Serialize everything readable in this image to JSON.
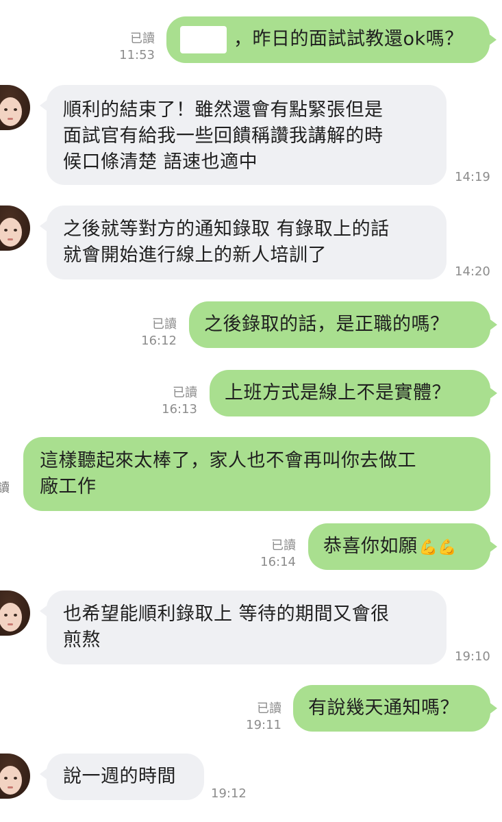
{
  "messages": [
    {
      "id": "m1",
      "side": "me",
      "status": "已讀",
      "time": "11:53",
      "text": "，昨日的面試試教還ok嗎？"
    },
    {
      "id": "m2",
      "side": "them",
      "time": "14:19",
      "lines": [
        "順利的結束了！雖然還會有點緊張但是",
        "面試官有給我一些回饋稱讚我講解的時",
        "候口條清楚 語速也適中"
      ]
    },
    {
      "id": "m3",
      "side": "them",
      "time": "14:20",
      "lines": [
        "之後就等對方的通知錄取 有錄取上的話",
        "就會開始進行線上的新人培訓了"
      ]
    },
    {
      "id": "m4",
      "side": "me",
      "status": "已讀",
      "time": "16:12",
      "text": "之後錄取的話，是正職的嗎？"
    },
    {
      "id": "m5",
      "side": "me",
      "status": "已讀",
      "time": "16:13",
      "text": "上班方式是線上不是實體？"
    },
    {
      "id": "m6",
      "side": "me",
      "status": "讀",
      "lines": [
        "這樣聽起來太棒了，家人也不會再叫你去做工",
        "廠工作"
      ]
    },
    {
      "id": "m7",
      "side": "me",
      "status": "已讀",
      "time": "16:14",
      "text": "恭喜你如願",
      "emoji": "💪💪"
    },
    {
      "id": "m8",
      "side": "them",
      "time": "19:10",
      "lines": [
        "也希望能順利錄取上 等待的期間又會很",
        "煎熬"
      ]
    },
    {
      "id": "m9",
      "side": "me",
      "status": "已讀",
      "time": "19:11",
      "text": "有說幾天通知嗎？"
    },
    {
      "id": "m10",
      "side": "them",
      "time": "19:12",
      "text": "說一週的時間"
    }
  ]
}
